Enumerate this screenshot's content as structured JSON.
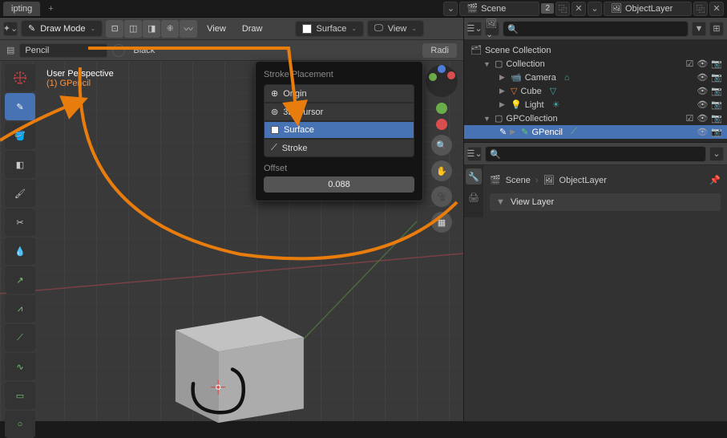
{
  "topbar": {
    "tab": "ipting",
    "scene_label": "Scene",
    "scene_count": "2",
    "layer_label": "ObjectLayer"
  },
  "toolbar": {
    "mode": "Draw Mode",
    "menu_view": "View",
    "menu_draw": "Draw",
    "placement_sel": "Surface",
    "view_dd": "View"
  },
  "subbar": {
    "material1": "Pencil",
    "material2": "Black",
    "radius": "Radi"
  },
  "overlay": {
    "perspective": "User Perspective",
    "object": "(1) GPencil"
  },
  "popover": {
    "title": "Stroke Placement",
    "items": [
      "Origin",
      "3D Cursor",
      "Surface",
      "Stroke"
    ],
    "offset_label": "Offset",
    "offset_value": "0.088"
  },
  "outliner": {
    "root": "Scene Collection",
    "collection": "Collection",
    "camera": "Camera",
    "cube": "Cube",
    "light": "Light",
    "gpcollection": "GPCollection",
    "gpencil": "GPencil"
  },
  "props": {
    "scene": "Scene",
    "layer": "ObjectLayer",
    "view_layer_panel": "View Layer"
  }
}
